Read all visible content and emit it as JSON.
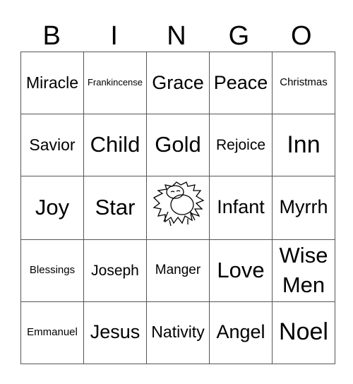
{
  "header": [
    "B",
    "I",
    "N",
    "G",
    "O"
  ],
  "rows": [
    [
      "Miracle",
      "Frankincense",
      "Grace",
      "Peace",
      "Christmas"
    ],
    [
      "Savior",
      "Child",
      "Gold",
      "Rejoice",
      "Inn"
    ],
    [
      "Joy",
      "Star",
      "[manger-image]",
      "Infant",
      "Myrrh"
    ],
    [
      "Blessings",
      "Joseph",
      "Manger",
      "Love",
      "Wise Men"
    ],
    [
      "Emmanuel",
      "Jesus",
      "Nativity",
      "Angel",
      "Noel"
    ]
  ],
  "free_space": {
    "icon": "baby-in-manger-icon"
  }
}
